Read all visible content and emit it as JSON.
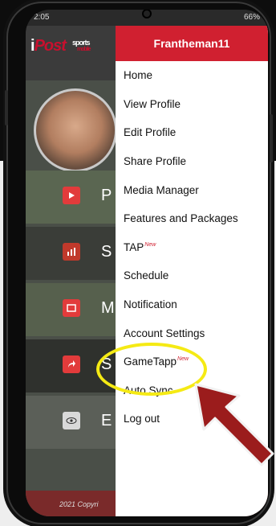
{
  "status_bar": {
    "time": "2:05",
    "signal": "66%"
  },
  "app": {
    "logo_i": "i",
    "logo_post": "Post",
    "logo_sports": "sports",
    "logo_mobile": "mobile",
    "rows": [
      {
        "label": "P",
        "icon": "play-icon",
        "color": "#e23b3b"
      },
      {
        "label": "S",
        "icon": "stats-icon",
        "color": "#c0392b"
      },
      {
        "label": "M",
        "icon": "media-icon",
        "color": "#e23b3b"
      },
      {
        "label": "S",
        "icon": "share-icon",
        "color": "#e23b3b"
      },
      {
        "label": "E",
        "icon": "eye-icon",
        "color": "#bfbfbf"
      }
    ],
    "footer": "2021 Copyri"
  },
  "drawer": {
    "username": "Frantheman11",
    "items": [
      {
        "label": "Home"
      },
      {
        "label": "View Profile"
      },
      {
        "label": "Edit Profile"
      },
      {
        "label": "Share Profile"
      },
      {
        "label": "Media Manager"
      },
      {
        "label": "Features and Packages"
      },
      {
        "label": "TAP",
        "badge": "New"
      },
      {
        "label": "Schedule"
      },
      {
        "label": "Notification"
      },
      {
        "label": "Account Settings"
      },
      {
        "label": "GameTapp",
        "badge": "New"
      },
      {
        "label": "Auto Sync"
      },
      {
        "label": "Log out"
      }
    ]
  },
  "colors": {
    "brand_red": "#d02030",
    "highlight": "#f5ea14",
    "arrow": "#9b1c1c"
  }
}
